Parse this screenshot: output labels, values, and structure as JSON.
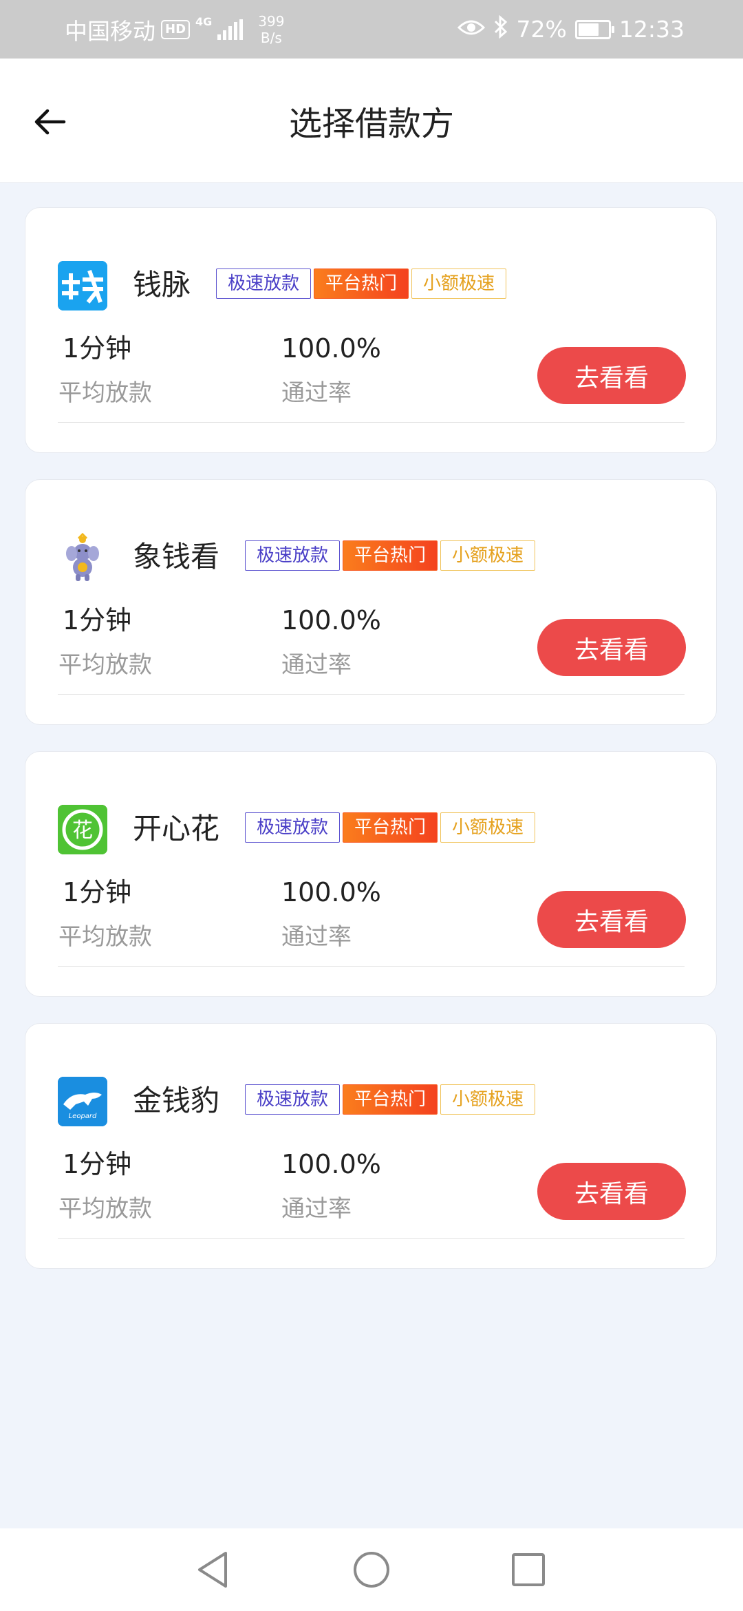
{
  "status_bar": {
    "carrier": "中国移动",
    "hd_badge": "HD",
    "network": "4G",
    "net_speed_value": "399",
    "net_speed_unit": "B/s",
    "battery_percent": "72%",
    "battery_level": 0.72,
    "time": "12:33"
  },
  "header": {
    "title": "选择借款方"
  },
  "tags": {
    "fast": "极速放款",
    "hot": "平台热门",
    "small": "小额极速"
  },
  "lenders": [
    {
      "name": "钱脉",
      "logo_text": "钱",
      "logo_color": "#1aa3ef",
      "loan_time": "1分钟",
      "loan_time_label": "平均放款",
      "pass_rate": "100.0%",
      "pass_rate_label": "通过率",
      "button": "去看看"
    },
    {
      "name": "象钱看",
      "logo_text": "",
      "logo_color": "#8d8fc9",
      "loan_time": "1分钟",
      "loan_time_label": "平均放款",
      "pass_rate": "100.0%",
      "pass_rate_label": "通过率",
      "button": "去看看"
    },
    {
      "name": "开心花",
      "logo_text": "花",
      "logo_color": "#4fc334",
      "loan_time": "1分钟",
      "loan_time_label": "平均放款",
      "pass_rate": "100.0%",
      "pass_rate_label": "通过率",
      "button": "去看看"
    },
    {
      "name": "金钱豹",
      "logo_text": "Leopard",
      "logo_color": "#1a8ee0",
      "loan_time": "1分钟",
      "loan_time_label": "平均放款",
      "pass_rate": "100.0%",
      "pass_rate_label": "通过率",
      "button": "去看看"
    }
  ]
}
